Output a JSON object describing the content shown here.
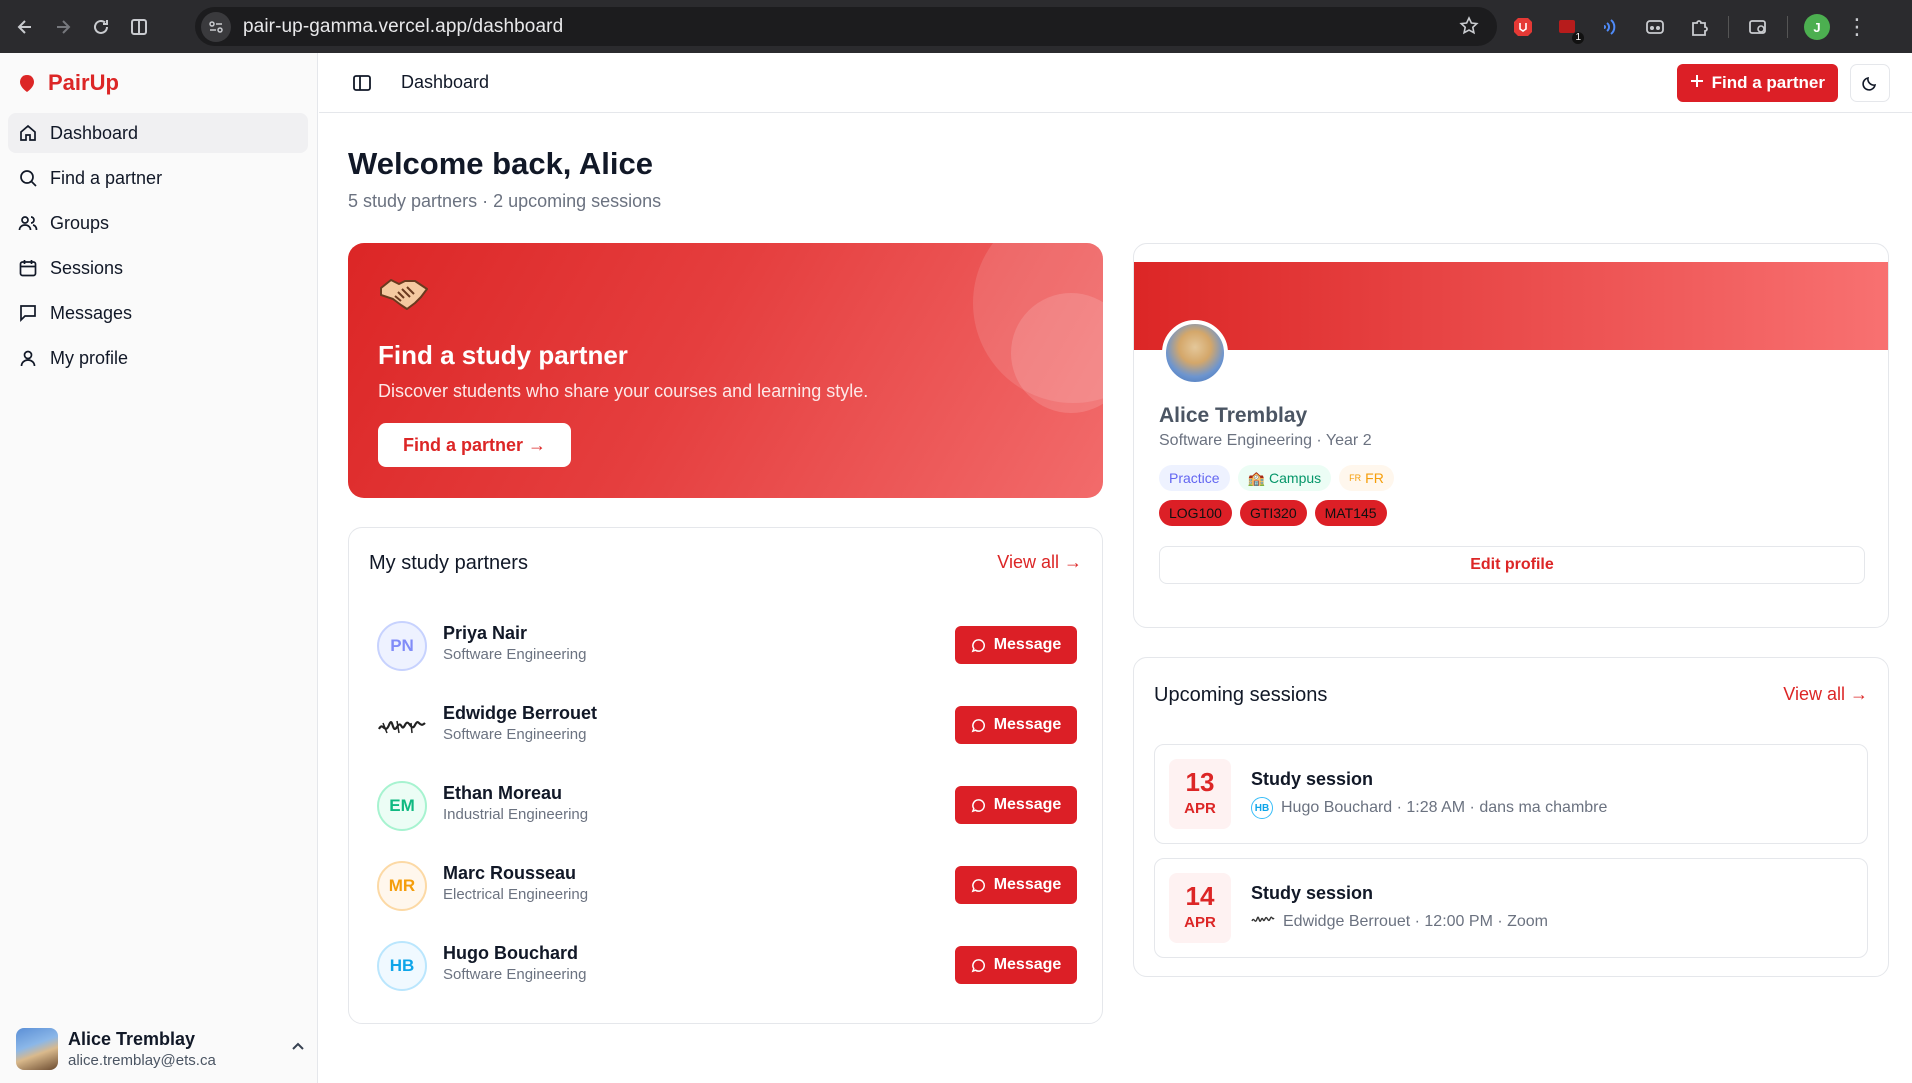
{
  "browser": {
    "url": "pair-up-gamma.vercel.app/dashboard",
    "extension_badge": "1",
    "profile_initial": "J"
  },
  "sidebar": {
    "brand": "PairUp",
    "items": [
      {
        "label": "Dashboard",
        "icon": "home-icon",
        "active": true
      },
      {
        "label": "Find a partner",
        "icon": "search-icon"
      },
      {
        "label": "Groups",
        "icon": "users-icon"
      },
      {
        "label": "Sessions",
        "icon": "calendar-icon"
      },
      {
        "label": "Messages",
        "icon": "message-icon"
      },
      {
        "label": "My profile",
        "icon": "user-icon"
      }
    ],
    "user": {
      "name": "Alice Tremblay",
      "email": "alice.tremblay@ets.ca"
    }
  },
  "topbar": {
    "breadcrumb": "Dashboard",
    "cta_label": "Find a partner"
  },
  "main": {
    "greeting": "Welcome back, Alice",
    "summary": "5 study partners · 2 upcoming sessions",
    "hero": {
      "title": "Find a study partner",
      "description": "Discover students who share your courses and learning style.",
      "button": "Find a partner →"
    },
    "partners": {
      "title": "My study partners",
      "view_all": "View all →",
      "message_label": "Message",
      "items": [
        {
          "initials": "PN",
          "name": "Priya Nair",
          "dept": "Software Engineering",
          "color": "#818cf8",
          "bg": "#eef2ff"
        },
        {
          "initials": "",
          "name": "Edwidge Berrouet",
          "dept": "Software Engineering",
          "color": "#374151",
          "bg": "#ffffff"
        },
        {
          "initials": "EM",
          "name": "Ethan Moreau",
          "dept": "Industrial Engineering",
          "color": "#34d399",
          "bg": "#ecfdf5"
        },
        {
          "initials": "MR",
          "name": "Marc Rousseau",
          "dept": "Electrical Engineering",
          "color": "#f59e0b",
          "bg": "#fff7ed"
        },
        {
          "initials": "HB",
          "name": "Hugo Bouchard",
          "dept": "Software Engineering",
          "color": "#38bdf8",
          "bg": "#f0f9ff"
        }
      ]
    },
    "profile": {
      "name": "Alice Tremblay",
      "subtitle": "Software Engineering · Year 2",
      "chips": {
        "practice": "Practice",
        "campus": "Campus",
        "lang_small": "FR",
        "lang": "FR"
      },
      "courses": [
        "LOG100",
        "GTI320",
        "MAT145"
      ],
      "edit_label": "Edit profile"
    },
    "sessions": {
      "title": "Upcoming sessions",
      "view_all": "View all →",
      "items": [
        {
          "day": "13",
          "month": "APR",
          "title": "Study session",
          "avatar": "HB",
          "meta": "Hugo Bouchard · 1:28 AM · dans ma chambre"
        },
        {
          "day": "14",
          "month": "APR",
          "title": "Study session",
          "avatar": "",
          "meta": "Edwidge Berrouet · 12:00 PM · Zoom"
        }
      ]
    }
  }
}
